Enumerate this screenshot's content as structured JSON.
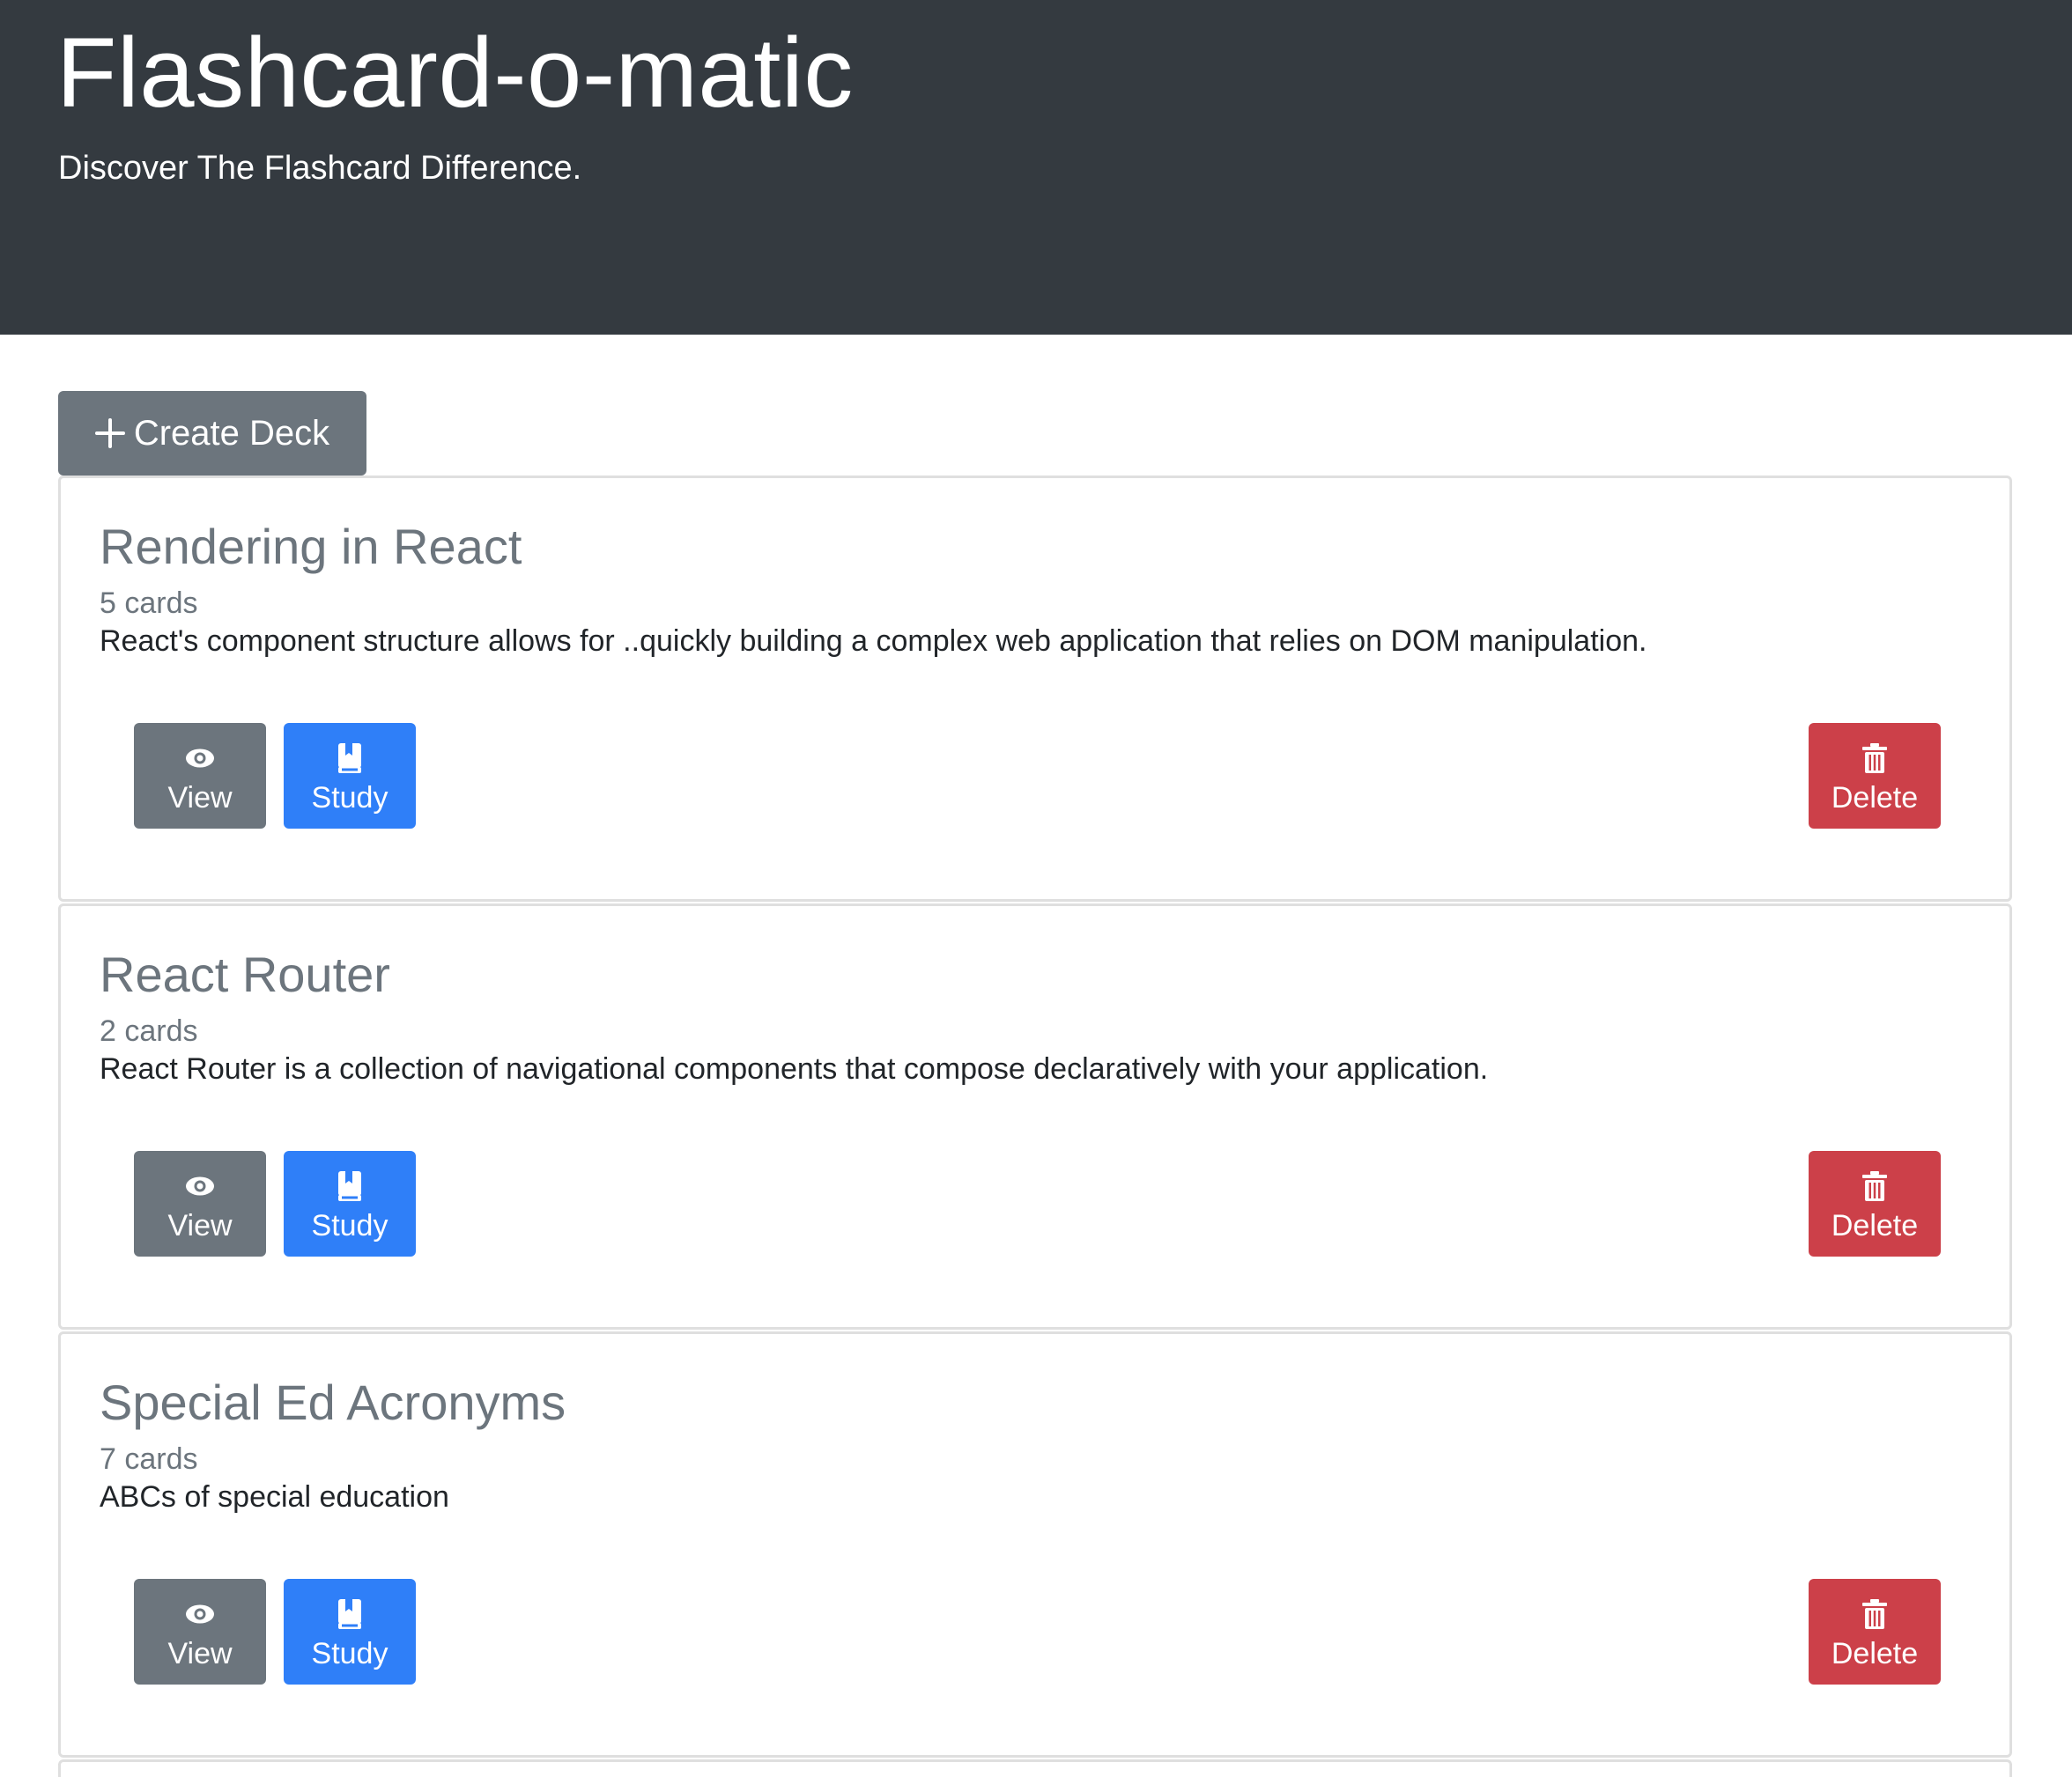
{
  "header": {
    "title": "Flashcard-o-matic",
    "subtitle": "Discover The Flashcard Difference."
  },
  "actions": {
    "create_deck_label": "Create Deck",
    "create_icon": "plus-icon"
  },
  "decks": [
    {
      "title": "Rendering in React",
      "count": "5 cards",
      "description": "React's component structure allows for ..quickly building a complex web application that relies on DOM manipulation.",
      "view_label": "View",
      "study_label": "Study",
      "delete_label": "Delete"
    },
    {
      "title": "React Router",
      "count": "2 cards",
      "description": "React Router is a collection of navigational components that compose declaratively with your application.",
      "view_label": "View",
      "study_label": "Study",
      "delete_label": "Delete"
    },
    {
      "title": "Special Ed Acronyms",
      "count": "7 cards",
      "description": "ABCs of special education",
      "view_label": "View",
      "study_label": "Study",
      "delete_label": "Delete"
    }
  ],
  "icons": {
    "view": "eye-icon",
    "study": "book-icon",
    "delete": "trash-icon"
  },
  "colors": {
    "header_bg": "#343a40",
    "secondary": "#6c757d",
    "primary": "#2f7ff8",
    "danger": "#cc4049"
  }
}
